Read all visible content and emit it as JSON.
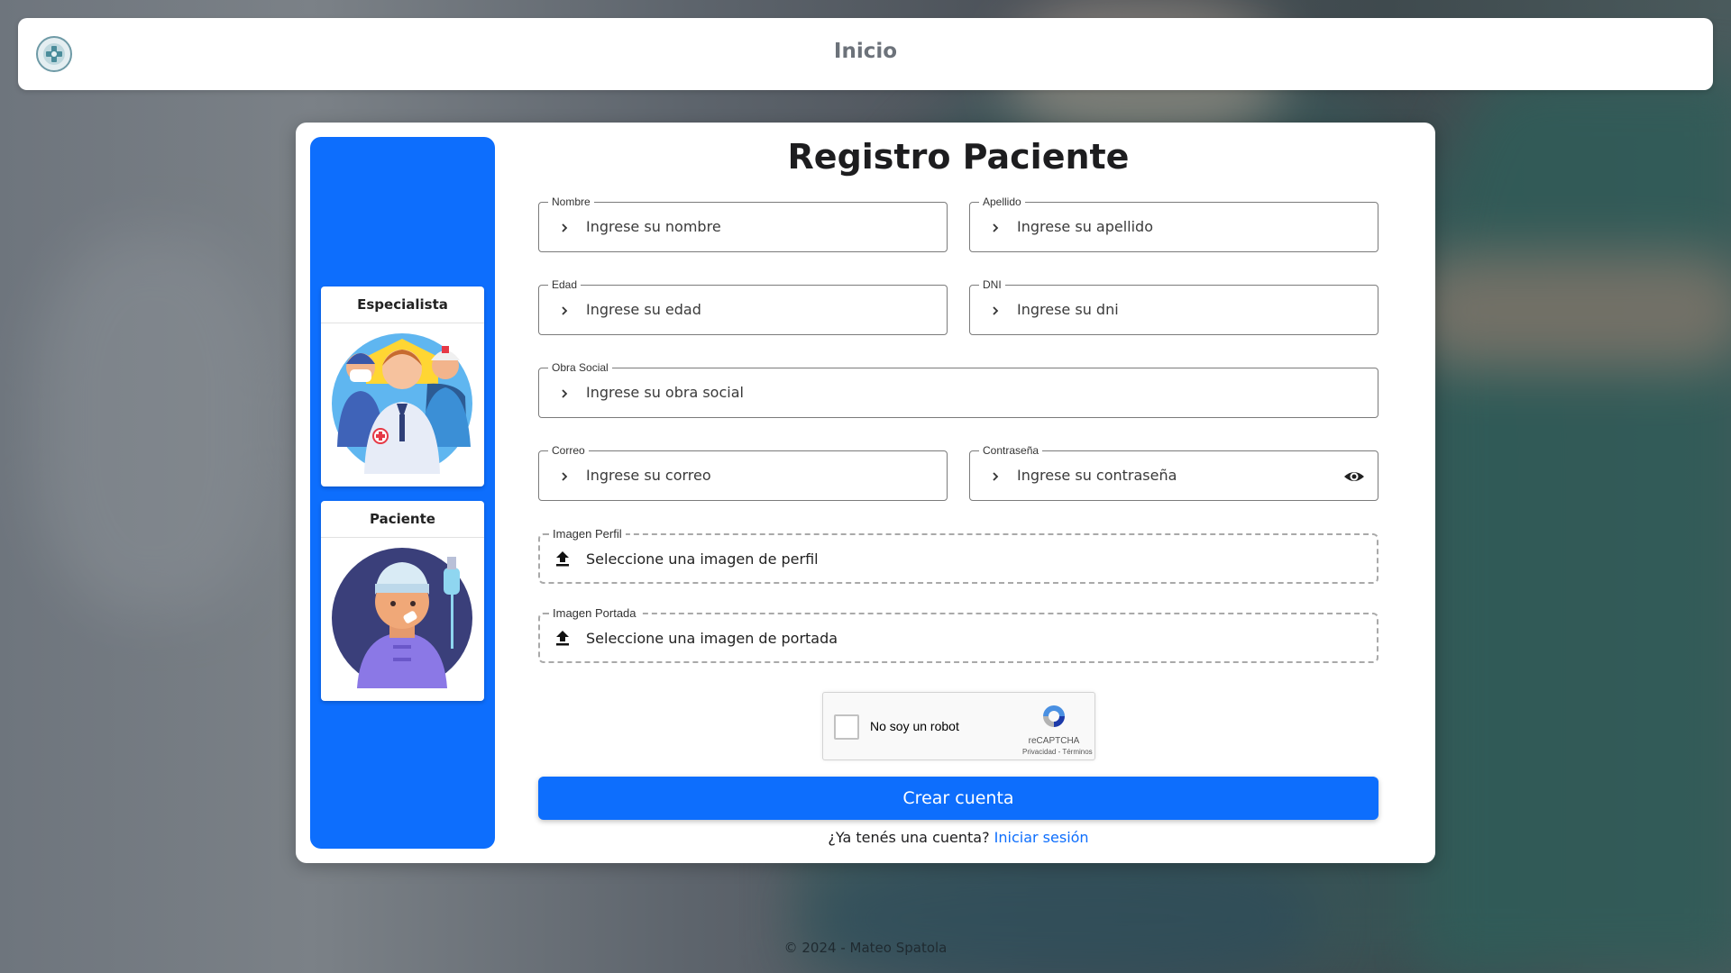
{
  "navbar": {
    "title": "Inicio",
    "logo_icon": "medical-logo-icon"
  },
  "roles": {
    "specialist": {
      "label": "Especialista"
    },
    "patient": {
      "label": "Paciente"
    }
  },
  "form": {
    "title": "Registro Paciente",
    "fields": {
      "nombre": {
        "label": "Nombre",
        "placeholder": "Ingrese su nombre"
      },
      "apellido": {
        "label": "Apellido",
        "placeholder": "Ingrese su apellido"
      },
      "edad": {
        "label": "Edad",
        "placeholder": "Ingrese su edad"
      },
      "dni": {
        "label": "DNI",
        "placeholder": "Ingrese su dni"
      },
      "obra_social": {
        "label": "Obra Social",
        "placeholder": "Ingrese su obra social"
      },
      "correo": {
        "label": "Correo",
        "placeholder": "Ingrese su correo"
      },
      "contrasena": {
        "label": "Contraseña",
        "placeholder": "Ingrese su contraseña"
      }
    },
    "uploads": {
      "perfil": {
        "label": "Imagen Perfil",
        "text": "Seleccione una imagen de perfil"
      },
      "portada": {
        "label": "Imagen Portada",
        "text": "Seleccione una imagen de portada"
      }
    },
    "captcha": {
      "label": "No soy un robot",
      "brand": "reCAPTCHA",
      "links": "Privacidad - Términos"
    },
    "submit_label": "Crear cuenta",
    "login_prompt": "¿Ya tenés una cuenta?",
    "login_link": "Iniciar sesión"
  },
  "footer": {
    "text": "© 2024 - Mateo Spatola"
  },
  "colors": {
    "primary": "#0d6efd",
    "card": "#ffffff",
    "text": "#1d1d1f"
  }
}
